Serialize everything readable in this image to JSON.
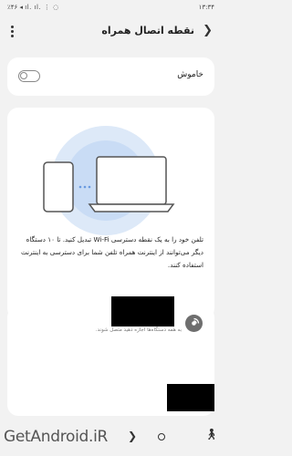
{
  "status_bar": {
    "time": "۱۳:۳۴",
    "left_text": "٪۴۶ ◂ ıl. ıl. ⋮ ◌"
  },
  "header": {
    "title": "نقطه اتصال همراه",
    "menu_icon": "more-vert-icon",
    "back_icon": "chevron-right-icon"
  },
  "toggle": {
    "label": "خاموش",
    "state": "off"
  },
  "description": "تلفن خود را به یک نقطه دسترسی Wi-Fi تبدیل کنید. تا ۱۰ دستگاه دیگر می‌توانند از اینترنت همراه تلفن شما برای دسترسی به اینترنت استفاده کنند.",
  "devices": {
    "hint": "به همه دستگاه‌ها اجازه دهید متصل شوند."
  },
  "watermark": "GetAndroid.iR",
  "colors": {
    "background": "#f2f2f2",
    "card": "#ffffff",
    "illustration_glow": "#c9dcf5"
  }
}
